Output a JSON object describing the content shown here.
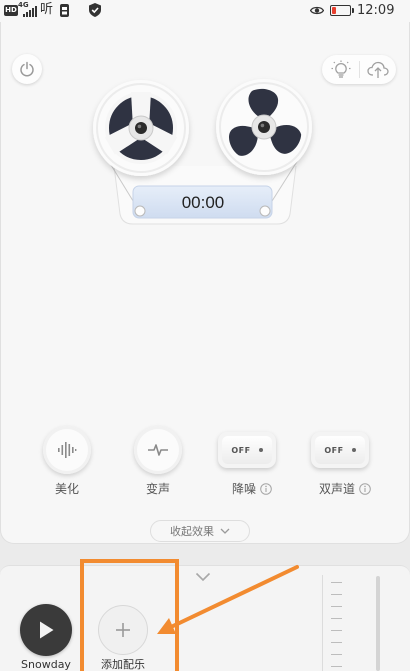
{
  "status_bar": {
    "hd_badge": "HD",
    "network_type": "4G",
    "notification_glyph": "听",
    "time": "12:09",
    "battery_level": 0.22,
    "battery_color": "#e8402f",
    "icons": [
      "signal-icon",
      "notification-icon",
      "shield-check-icon",
      "eye-comfort-icon",
      "battery-icon"
    ]
  },
  "toolbar": {
    "power_icon": "power-icon",
    "tips_icon": "lightbulb-icon",
    "upload_icon": "cloud-upload-icon"
  },
  "recorder": {
    "timer": "00:00",
    "reel_icon": "tape-reel-icon"
  },
  "effects": [
    {
      "label": "美化",
      "icon": "waveform-icon"
    },
    {
      "label": "变声",
      "icon": "pulse-icon"
    },
    {
      "label": "降噪",
      "icon": "info-icon",
      "state": "OFF"
    },
    {
      "label": "双声道",
      "icon": "info-icon",
      "state": "OFF"
    }
  ],
  "collapse_effects": {
    "label": "收起效果",
    "icon": "chevron-down-icon"
  },
  "music_bar": {
    "expand_icon": "chevron-down-icon",
    "current_track": "Snowday",
    "play_icon": "play-icon",
    "add_music_label": "添加配乐",
    "add_icon": "plus-icon"
  },
  "colors": {
    "panel": "#f7f7f7",
    "timer_display": "#dbe6f5",
    "play_button": "#3a3a3a",
    "annotation": "#f28b30"
  }
}
